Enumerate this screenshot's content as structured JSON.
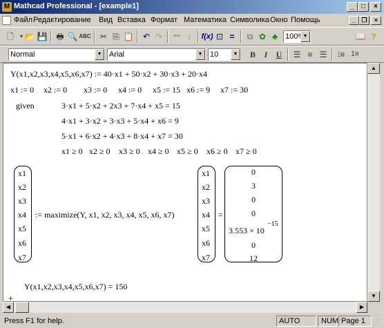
{
  "window": {
    "title": "Mathcad Professional - [example1]",
    "minimize": "_",
    "maximize": "□",
    "close": "×"
  },
  "menu": [
    "Файл",
    "Редактирование",
    "Вид",
    "Вставка",
    "Формат",
    "Математика",
    "Символика",
    "Окно",
    "Помощь"
  ],
  "toolbar": {
    "zoom": "100%"
  },
  "format_bar": {
    "style": "Normal",
    "font": "Arial",
    "size": "10",
    "bold": "B",
    "italic": "I",
    "underline": "U"
  },
  "worksheet": {
    "objective": "Y(x1,x2,x3,x4,x5,x6,x7) := 40·x1 + 50·x2 + 30·x3 + 20·x4",
    "initial": [
      {
        "text": "x1 := 0"
      },
      {
        "text": "x2 := 0"
      },
      {
        "text": "x3 := 0"
      },
      {
        "text": "x4 := 0"
      },
      {
        "text": "x5 := 15"
      },
      {
        "text": "x6 := 9"
      },
      {
        "text": "x7 := 30"
      }
    ],
    "given": "given",
    "constraints": [
      "3·x1 + 5·x2 + 2x3 + 7·x4 + x5 = 15",
      "4·x1 + 3·x2 + 3·x3 + 5·x4 + x6 = 9",
      "5·x1 + 6·x2 + 4·x3 + 8·x4 + x7 = 30"
    ],
    "nonneg": [
      "x1 ≥ 0",
      "x2 ≥ 0",
      "x3 ≥ 0",
      "x4 ≥ 0",
      "x5 ≥ 0",
      "x6 ≥ 0",
      "x7 ≥ 0"
    ],
    "vars": [
      "x1",
      "x2",
      "x3",
      "x4",
      "x5",
      "x6",
      "x7"
    ],
    "maximize_expr": ":= maximize(Y, x1, x2, x3, x4, x5, x6, x7)",
    "equals": "=",
    "result": [
      "0",
      "3",
      "0",
      "0",
      "3.553 × 10",
      "0",
      "12"
    ],
    "result_exponent": "−15",
    "final": "Y(x1,x2,x3,x4,x5,x6,x7) = 150"
  },
  "status": {
    "help": "Press F1 for help.",
    "mode": "AUTO",
    "num": "NUM",
    "page": "Page 1"
  }
}
